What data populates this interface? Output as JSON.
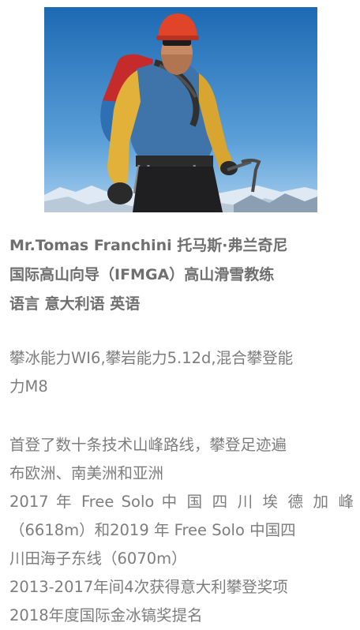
{
  "profile": {
    "name_line": "Mr.Tomas Franchini 托马斯·弗兰奇尼",
    "role_line": "国际高山向导（IFMGA）高山滑雪教练",
    "language_line": "语言 意大利语 英语"
  },
  "abilities": {
    "line1": "攀冰能力WI6,攀岩能力5.12d,混合攀登能",
    "line2": "力M8"
  },
  "achievements": {
    "line1": "首登了数十条技术山峰路线，攀登足迹遍",
    "line2": "布欧洲、南美洲和亚洲",
    "line3": "2017 年 Free Solo 中 国 四 川 埃 德 加 峰",
    "line4": "（6618m）和2019 年 Free Solo 中国四",
    "line5": "川田海子东线（6070m）",
    "line6": "2013-2017年间4次获得意大利攀登奖项",
    "line7": "2018年度国际金冰镐奖提名"
  },
  "colors": {
    "sky_top": "#1f6fb8",
    "sky_bottom": "#8fc0e6",
    "jacket_yellow": "#e2b13a",
    "jacket_blue": "#3a6fa6",
    "helmet": "#e0452a",
    "text": "#7a7a7a"
  }
}
